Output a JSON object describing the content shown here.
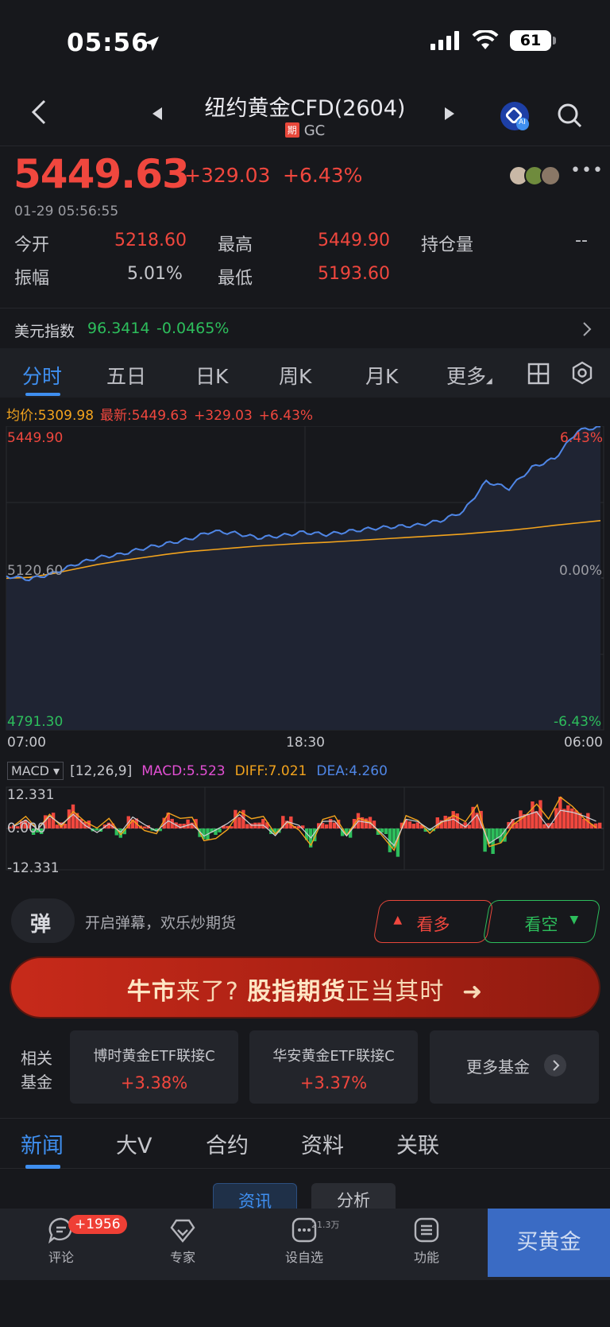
{
  "status_bar": {
    "time": "05:56",
    "battery": "61"
  },
  "nav": {
    "title": "纽约黄金CFD(2604)",
    "tag": "期",
    "code": "GC",
    "ai_label": "AI"
  },
  "quote": {
    "price": "5449.63",
    "change": "+329.03",
    "change_pct": "+6.43%",
    "time": "01-29 05:56:55",
    "open_label": "今开",
    "open": "5218.60",
    "high_label": "最高",
    "high": "5449.90",
    "oi_label": "持仓量",
    "oi": "--",
    "amp_label": "振幅",
    "amp": "5.01%",
    "low_label": "最低",
    "low": "5193.60"
  },
  "dxy": {
    "label": "美元指数",
    "value": "96.3414",
    "change_pct": "-0.0465%"
  },
  "tabs": [
    "分时",
    "五日",
    "日K",
    "周K",
    "月K",
    "更多"
  ],
  "legend": {
    "avg": "均价:5309.98",
    "last": "最新:5449.63",
    "change": "+329.03",
    "change_pct": "+6.43%"
  },
  "chart_labels": {
    "y_top": "5449.90",
    "y_mid": "5120.60",
    "y_bottom": "4791.30",
    "pct_top": "6.43%",
    "pct_mid": "0.00%",
    "pct_bottom": "-6.43%",
    "x_start": "07:00",
    "x_mid": "18:30",
    "x_end": "06:00"
  },
  "chart_data": {
    "type": "line",
    "x": [
      "07:00",
      "18:30",
      "06:00"
    ],
    "ylim": [
      4791.3,
      5449.9
    ],
    "series": [
      {
        "name": "最新",
        "values": [
          5125,
          5118,
          5130,
          5150,
          5165,
          5172,
          5185,
          5195,
          5205,
          5222,
          5218,
          5208,
          5212,
          5220,
          5215,
          5222,
          5228,
          5232,
          5235,
          5245,
          5265,
          5330,
          5315,
          5360,
          5380,
          5440,
          5449
        ]
      },
      {
        "name": "均价",
        "values": [
          5120,
          5122,
          5130,
          5140,
          5150,
          5158,
          5165,
          5172,
          5178,
          5182,
          5186,
          5190,
          5193,
          5196,
          5198,
          5201,
          5204,
          5207,
          5210,
          5213,
          5216,
          5220,
          5224,
          5229,
          5235,
          5240,
          5245
        ]
      }
    ],
    "color_last": "#4f86e6",
    "color_avg": "#f2a31d"
  },
  "macd": {
    "selector": "MACD",
    "params": "[12,26,9]",
    "macd": "MACD:5.523",
    "diff": "DIFF:7.021",
    "dea": "DEA:4.260",
    "y_top": "12.331",
    "y_mid": "0.000",
    "y_bottom": "-12.331",
    "values": [
      1,
      3,
      -2,
      5,
      2,
      8,
      3,
      -1,
      2,
      -3,
      4,
      1,
      -1,
      5,
      2,
      3,
      -4,
      -2,
      1,
      6,
      2,
      3,
      -2,
      4,
      1,
      -6,
      2,
      3,
      -3,
      5,
      4,
      -2,
      -9,
      3,
      2,
      -1,
      4,
      6,
      2,
      7,
      -8,
      -5,
      3,
      6,
      9,
      2,
      10,
      8,
      5,
      2
    ]
  },
  "danmu": {
    "icon_char": "弹",
    "text": "开启弹幕，欢乐炒期货",
    "bull": "看多",
    "bear": "看空"
  },
  "banner": {
    "part1": "牛市",
    "part2": "来了?",
    "part3": "股指期货",
    "part4": "正当其时"
  },
  "funds": {
    "label_line1": "相关",
    "label_line2": "基金",
    "items": [
      {
        "name": "博时黄金ETF联接C",
        "pct": "+3.38%"
      },
      {
        "name": "华安黄金ETF联接C",
        "pct": "+3.37%"
      }
    ],
    "more": "更多基金"
  },
  "news_tabs": [
    "新闻",
    "大V",
    "合约",
    "资料",
    "关联"
  ],
  "subtabs": [
    "资讯",
    "分析"
  ],
  "bottom_bar": {
    "comment": "评论",
    "comment_badge": "+1956",
    "expert": "专家",
    "watch": "设自选",
    "watch_count": "21.3万",
    "func": "功能",
    "buy": "买黄金"
  },
  "colors": {
    "up": "#f0473e",
    "down": "#2dbe5c",
    "accent": "#3f8ff0",
    "bg": "#17181c"
  }
}
